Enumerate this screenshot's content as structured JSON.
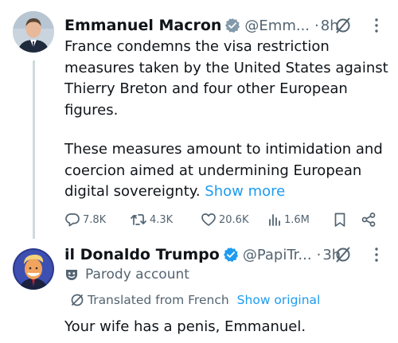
{
  "tweets": [
    {
      "author_name": "Emmanuel Macron",
      "handle": "@Emm...",
      "separator": "·",
      "time": "8h",
      "text_lines": [
        "France condemns the visa restriction",
        "measures taken by the United States against",
        "Thierry Breton and four other European",
        "figures."
      ],
      "text_lines_2": [
        "These measures amount to intimidation and",
        "coercion aimed at undermining European",
        "digital sovereignty."
      ],
      "show_more_label": "Show more",
      "actions": {
        "replies": "7.8K",
        "reposts": "4.3K",
        "likes": "20.6K",
        "views": "1.6M"
      }
    },
    {
      "author_name": "il Donaldo Trumpo",
      "handle": "@PapiTr...",
      "separator": "·",
      "time": "3h",
      "parody_label": "Parody account",
      "translated_label": "Translated from French",
      "show_original_label": "Show original",
      "text": "Your wife has a penis, Emmanuel."
    }
  ],
  "icons": {
    "verified": "verified-badge-icon",
    "grok": "grok-icon",
    "more": "more-icon",
    "reply": "reply-icon",
    "repost": "repost-icon",
    "like": "like-icon",
    "views": "views-icon",
    "bookmark": "bookmark-icon",
    "share": "share-icon",
    "parody": "parody-mask-icon",
    "translate": "translate-icon"
  },
  "colors": {
    "text": "#0f1419",
    "secondary": "#536471",
    "accent": "#1d9bf0",
    "thread_line": "#cfd9de"
  }
}
